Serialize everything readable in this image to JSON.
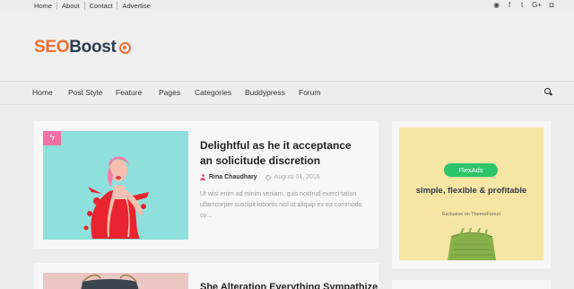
{
  "topbar": {
    "links": [
      "Home",
      "About",
      "Contact",
      "Advertise"
    ],
    "social_icons": [
      "rss-icon",
      "facebook-icon",
      "twitter-icon",
      "google-plus-icon",
      "instagram-icon"
    ],
    "social_glyphs": [
      "◉",
      "f",
      "t",
      "G+",
      "◘"
    ]
  },
  "header": {
    "logo_part1": "SEO",
    "logo_part2": "Boost"
  },
  "nav": {
    "items": [
      "Home",
      "Post Style",
      "Feature",
      "Pages",
      "Categories",
      "Buddypress",
      "Forum"
    ]
  },
  "posts": [
    {
      "title": "Delightful as he it acceptance an solicitude discretion",
      "author": "Rina Chaudhary",
      "date": "August 01, 2016",
      "excerpt": "Ut wisi enim ad minim veniam, quis nostrud exerci tation ullamcorper suscipit lobortis nisl ut aliquip ex ea commodo co...",
      "badge_icon": "lightning-icon"
    },
    {
      "title": "She Alteration Everything Sympathize"
    }
  ],
  "ad": {
    "brand": "FlexAds",
    "headline": "simple, flexible & profitable",
    "sub": "Exclusive on ThemeForest"
  },
  "colors": {
    "brand_orange": "#f06d2f",
    "brand_dark": "#2e3a4d",
    "accent_pink": "#f06fa4",
    "ad_green": "#2ec469",
    "ad_bg": "#f7e5a4"
  }
}
